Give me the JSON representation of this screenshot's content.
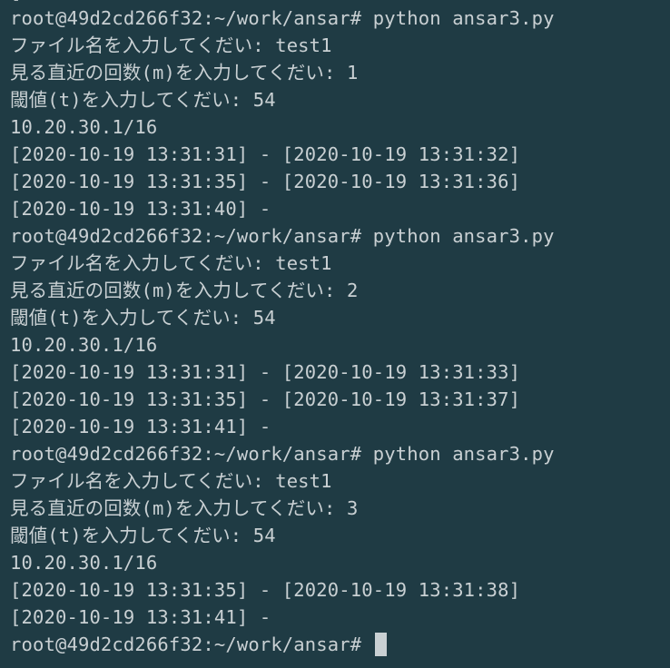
{
  "terminal": {
    "top_partial": "[",
    "lines": [
      "root@49d2cd266f32:~/work/ansar# python ansar3.py",
      "ファイル名を入力してくだい: test1",
      "見る直近の回数(m)を入力してくだい: 1",
      "閾値(t)を入力してくだい: 54",
      "10.20.30.1/16",
      "[2020-10-19 13:31:31] - [2020-10-19 13:31:32]",
      "[2020-10-19 13:31:35] - [2020-10-19 13:31:36]",
      "[2020-10-19 13:31:40] -",
      "root@49d2cd266f32:~/work/ansar# python ansar3.py",
      "ファイル名を入力してくだい: test1",
      "見る直近の回数(m)を入力してくだい: 2",
      "閾値(t)を入力してくだい: 54",
      "10.20.30.1/16",
      "[2020-10-19 13:31:31] - [2020-10-19 13:31:33]",
      "[2020-10-19 13:31:35] - [2020-10-19 13:31:37]",
      "[2020-10-19 13:31:41] -",
      "root@49d2cd266f32:~/work/ansar# python ansar3.py",
      "ファイル名を入力してくだい: test1",
      "見る直近の回数(m)を入力してくだい: 3",
      "閾値(t)を入力してくだい: 54",
      "10.20.30.1/16",
      "[2020-10-19 13:31:35] - [2020-10-19 13:31:38]",
      "[2020-10-19 13:31:41] -"
    ],
    "prompt": "root@49d2cd266f32:~/work/ansar# ",
    "colors": {
      "background": "#1f3b44",
      "foreground": "#c9d0d3",
      "cursor": "#c9d0d3"
    }
  }
}
